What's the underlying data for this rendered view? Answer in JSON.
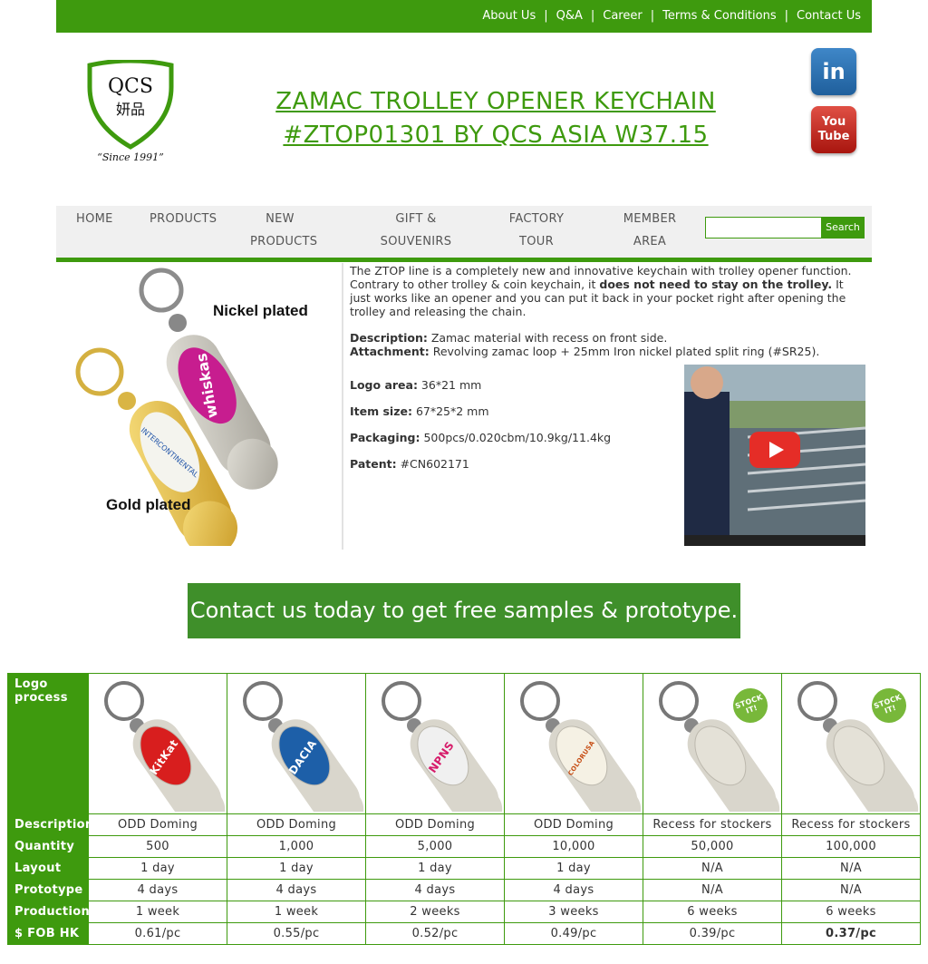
{
  "topnav": {
    "links": [
      "About Us",
      "Q&A",
      "Career",
      "Terms & Conditions",
      "Contact Us"
    ],
    "separator": "|"
  },
  "logo": {
    "text_main": "QCS",
    "text_chinese": "妍品",
    "since": "“Since 1991”"
  },
  "header": {
    "title_line1": "ZAMAC TROLLEY OPENER KEYCHAIN",
    "title_line2": "#ZTOP01301 BY QCS ASIA W37.15"
  },
  "social": {
    "linkedin": "in",
    "youtube_line1": "You",
    "youtube_line2": "Tube"
  },
  "nav": {
    "home": "HOME",
    "products": "PRODUCTS",
    "new_products_1": "NEW",
    "new_products_2": "PRODUCTS",
    "gift_1": "GIFT &",
    "gift_2": "SOUVENIRS",
    "factory_1": "FACTORY",
    "factory_2": "TOUR",
    "member_1": "MEMBER",
    "member_2": "AREA",
    "search_button": "Search",
    "search_value": ""
  },
  "product_image": {
    "nickel_label": "Nickel plated",
    "gold_label": "Gold plated",
    "pink_brand": "whiskas",
    "white_brand": "INTERCONTINENTAL"
  },
  "description": {
    "intro_a": "The ZTOP line is a completely new and innovative keychain with trolley opener function. Contrary to other trolley & coin keychain, it ",
    "intro_bold": "does not need to stay on the trolley.",
    "intro_b": " It just works like an opener and you can put it back in your pocket right after opening the trolley and releasing the chain.",
    "desc_label": "Description:",
    "desc_value": " Zamac material with recess on front side.",
    "attach_label": "Attachment:",
    "attach_value": " Revolving zamac loop + 25mm Iron nickel plated split ring (#SR25).",
    "logo_label": "Logo area:",
    "logo_value": " 36*21 mm",
    "size_label": "Item size:",
    "size_value": " 67*25*2 mm",
    "pack_label": "Packaging:",
    "pack_value": " 500pcs/0.020cbm/10.9kg/11.4kg",
    "patent_label": "Patent:",
    "patent_value": " #CN602171"
  },
  "cta": {
    "label": "Contact us today to get free samples & prototype."
  },
  "table": {
    "row_labels": {
      "logo": "Logo process",
      "description": "Description",
      "quantity": "Quantity",
      "layout": "Layout",
      "prototype": "Prototype",
      "production": "Production",
      "fob": "$ FOB HK"
    },
    "columns": [
      {
        "brand": "KitKat",
        "description": "ODD Doming",
        "quantity": "500",
        "layout": "1 day",
        "prototype": "4 days",
        "production": "1 week",
        "fob": "0.61/pc"
      },
      {
        "brand": "DACIA",
        "description": "ODD Doming",
        "quantity": "1,000",
        "layout": "1 day",
        "prototype": "4 days",
        "production": "1 week",
        "fob": "0.55/pc"
      },
      {
        "brand": "NPNS",
        "description": "ODD Doming",
        "quantity": "5,000",
        "layout": "1 day",
        "prototype": "4 days",
        "production": "2 weeks",
        "fob": "0.52/pc"
      },
      {
        "brand": "COLORUSA",
        "description": "ODD Doming",
        "quantity": "10,000",
        "layout": "1 day",
        "prototype": "4 days",
        "production": "3 weeks",
        "fob": "0.49/pc"
      },
      {
        "brand": "",
        "stock": "STOCK IT!",
        "description": "Recess for stockers",
        "quantity": "50,000",
        "layout": "N/A",
        "prototype": "N/A",
        "production": "6 weeks",
        "fob": "0.39/pc"
      },
      {
        "brand": "",
        "stock": "STOCK IT!",
        "description": "Recess for stockers",
        "quantity": "100,000",
        "layout": "N/A",
        "prototype": "N/A",
        "production": "6 weeks",
        "fob": "0.37/pc"
      }
    ]
  },
  "colors": {
    "brand_green": "#3e9a0e",
    "cta_green": "#3f8f2a",
    "price_red": "#e02a1a"
  }
}
